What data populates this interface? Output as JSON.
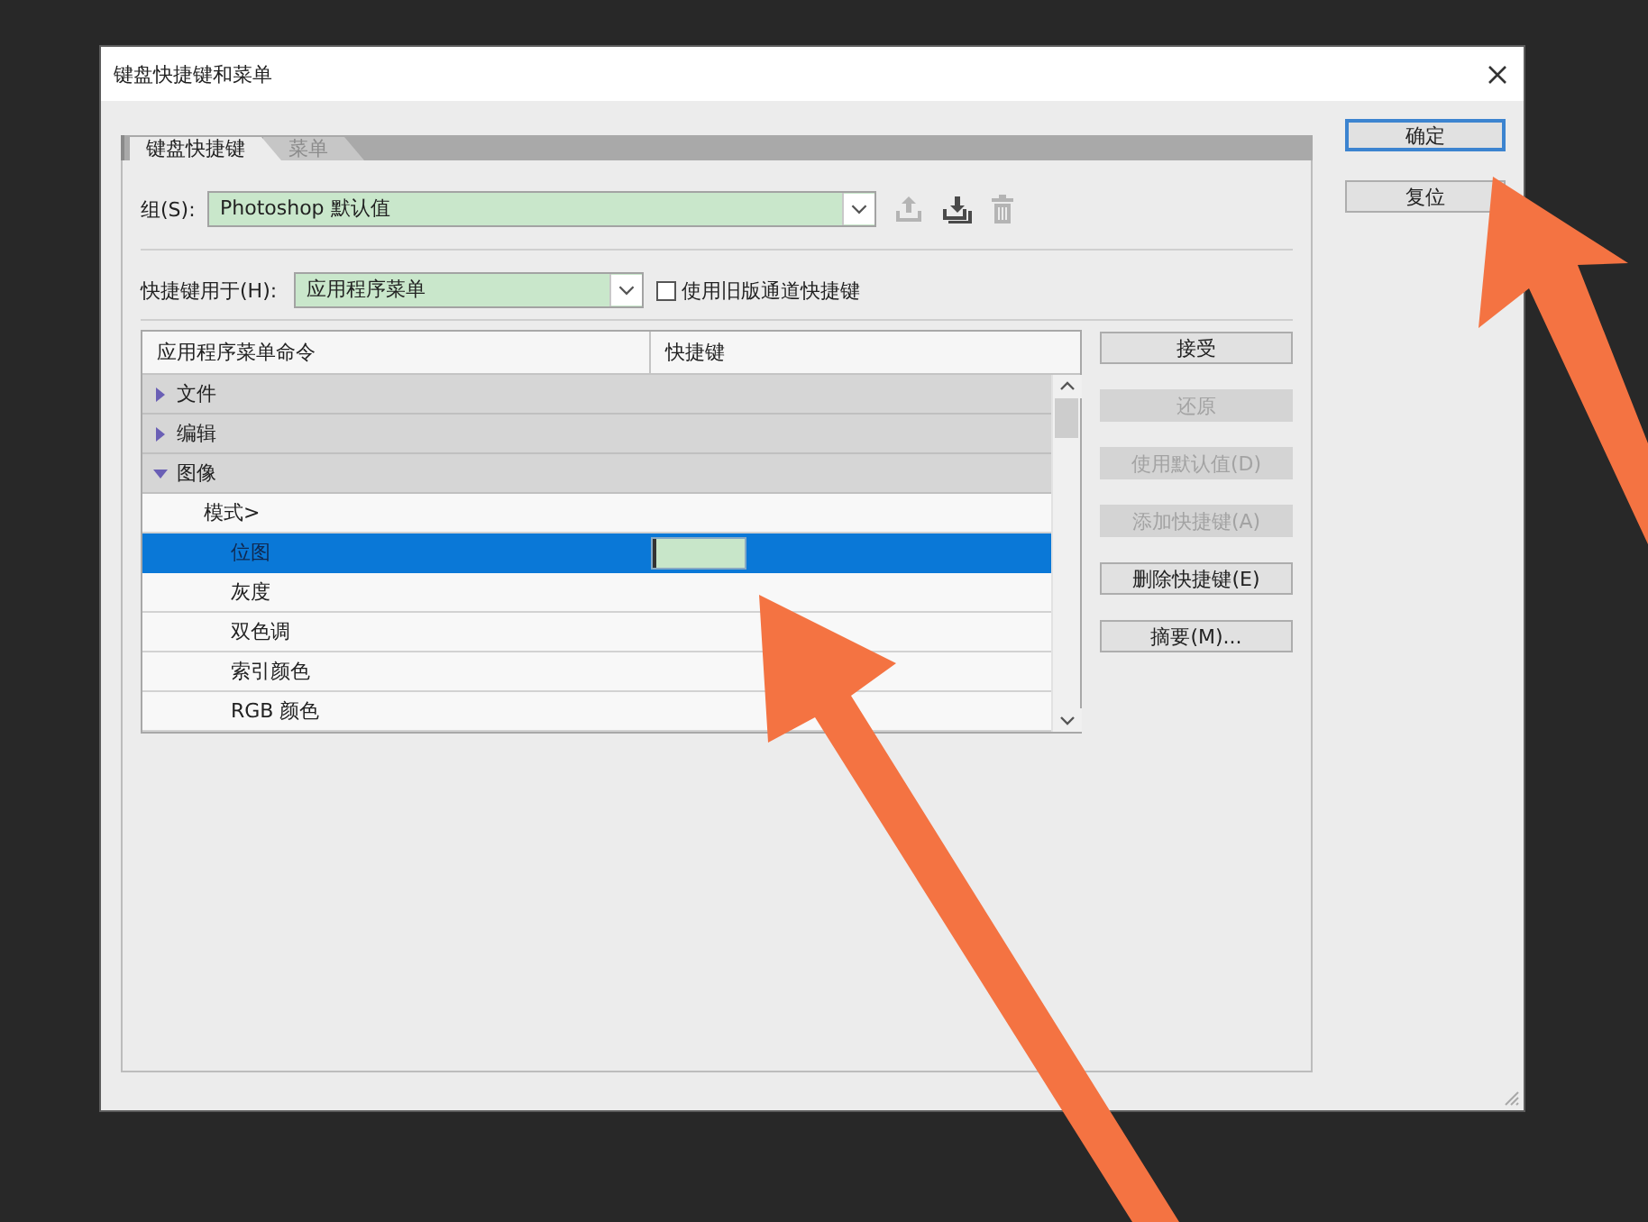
{
  "window": {
    "title": "键盘快捷键和菜单"
  },
  "tabs": [
    {
      "label": "键盘快捷键",
      "selected": true
    },
    {
      "label": "菜单",
      "selected": false
    }
  ],
  "group": {
    "label": "组(S):",
    "value": "Photoshop 默认值",
    "tools": [
      {
        "kind": "save",
        "disabled": true
      },
      {
        "kind": "save_as",
        "disabled": false
      },
      {
        "kind": "delete",
        "disabled": true
      }
    ]
  },
  "shortcuts_for": {
    "label": "快捷键用于(H):",
    "value": "应用程序菜单"
  },
  "legacy_channel_shortcuts": {
    "label": "使用旧版通道快捷键",
    "checked": false
  },
  "table": {
    "columns": [
      "应用程序菜单命令",
      "快捷键"
    ],
    "rows": [
      {
        "label": "文件",
        "expanded": false,
        "selected": false
      },
      {
        "label": "编辑",
        "expanded": false,
        "selected": false
      },
      {
        "label": "图像",
        "expanded": true,
        "selected": false,
        "children": [
          {
            "label": "模式>",
            "selected": false,
            "children": [
              {
                "label": "位图",
                "selected": true
              },
              {
                "label": "灰度",
                "selected": false
              },
              {
                "label": "双色调",
                "selected": false
              },
              {
                "label": "索引颜色",
                "selected": false
              },
              {
                "label": "RGB 颜色",
                "selected": false
              }
            ]
          }
        ]
      }
    ]
  },
  "side_buttons": [
    {
      "label": "接受",
      "disabled": false
    },
    {
      "label": "还原",
      "disabled": true
    },
    {
      "label": "使用默认值(D)",
      "disabled": true
    },
    {
      "label": "添加快捷键(A)",
      "disabled": true
    },
    {
      "label": "删除快捷键(E)",
      "disabled": false
    },
    {
      "label": "摘要(M)...",
      "disabled": false
    }
  ],
  "dialog_buttons": [
    {
      "label": "确定",
      "default": true
    },
    {
      "label": "复位",
      "default": false
    }
  ],
  "annotations": [
    {
      "kind": "arrow"
    },
    {
      "kind": "arrow"
    }
  ]
}
